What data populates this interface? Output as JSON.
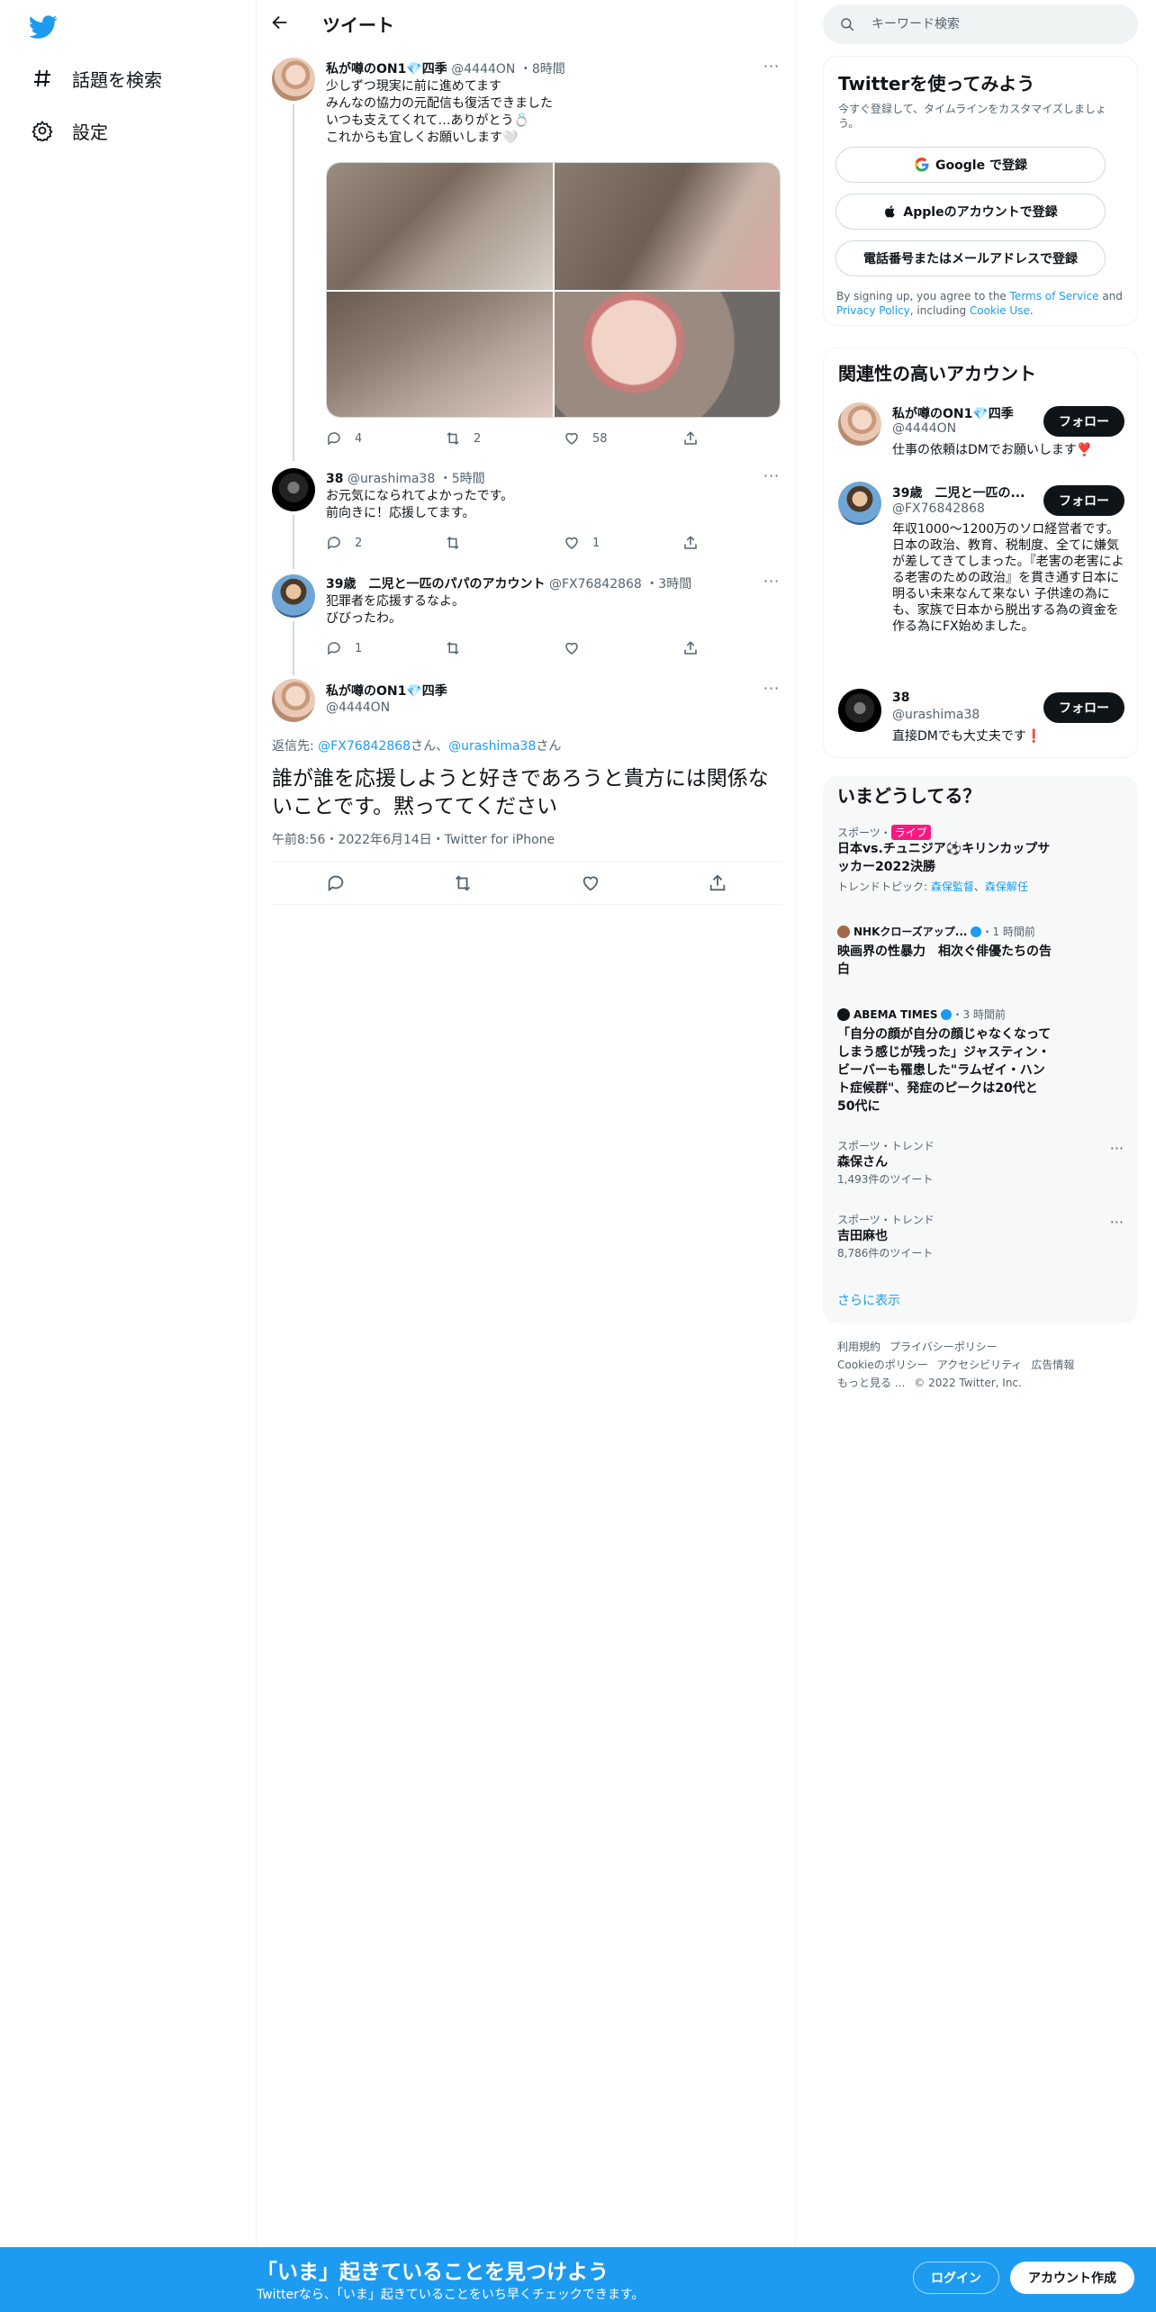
{
  "nav": {
    "explore_label": "話題を検索",
    "settings_label": "設定"
  },
  "header": {
    "title": "ツイート"
  },
  "tweets": [
    {
      "name": "私が噂のON1💎四季",
      "handle": "@4444ON",
      "time": "8時間",
      "text": "少しずつ現実に前に進めてます\nみんなの協力の元配信も復活できました\nいつも支えてくれて…ありがとう💍\nこれからも宜しくお願いします🤍",
      "replies": "4",
      "retweets": "2",
      "likes": "58"
    },
    {
      "name": "38",
      "handle": "@urashima38",
      "time": "5時間",
      "text": "お元気になられてよかったです。\n前向きに！応援してます。",
      "replies": "2",
      "retweets": "",
      "likes": "1"
    },
    {
      "name": "39歳　二児と一匹のパパのアカウント",
      "handle": "@FX76842868",
      "time": "3時間",
      "text": "犯罪者を応援するなよ。\nびびったわ。",
      "replies": "1",
      "retweets": "",
      "likes": ""
    }
  ],
  "focused": {
    "name": "私が噂のON1💎四季",
    "handle": "@4444ON",
    "reply_prefix": "返信先: ",
    "reply_to_1": "@FX76842868",
    "reply_san_1": "さん、",
    "reply_to_2": "@urashima38",
    "reply_san_2": "さん",
    "text": "誰が誰を応援しようと好きであろうと貴方には関係ないことです。黙っててください",
    "meta": "午前8:56・2022年6月14日・Twitter for iPhone"
  },
  "search": {
    "placeholder": "キーワード検索"
  },
  "signup": {
    "title": "Twitterを使ってみよう",
    "subtitle": "今すぐ登録して、タイムラインをカスタマイズしましょう。",
    "google": "Google で登録",
    "apple": "Appleのアカウントで登録",
    "phone": "電話番号またはメールアドレスで登録",
    "legal_1": "By signing up, you agree to the ",
    "terms": "Terms of Service",
    "legal_2": " and ",
    "privacy": "Privacy Policy",
    "legal_3": ", including ",
    "cookie": "Cookie Use",
    "legal_4": "."
  },
  "related": {
    "title": "関連性の高いアカウント",
    "follow": "フォロー",
    "accounts": [
      {
        "name": "私が噂のON1💎四季",
        "handle": "@4444ON",
        "bio": "仕事の依頼はDMでお願いします❣️"
      },
      {
        "name": "39歳　二児と一匹の...",
        "handle": "@FX76842868",
        "bio": "年収1000～1200万のソロ経営者です。 日本の政治、教育、税制度、全てに嫌気が差してきてしまった。『老害の老害による老害のための政治』を貫き通す日本に明るい未来なんて来ない 子供達の為にも、家族で日本から脱出する為の資金を作る為にFX始めました。"
      },
      {
        "name": "38",
        "handle": "@urashima38",
        "bio": "直接DMでも大丈夫です❗️"
      }
    ]
  },
  "trends": {
    "title": "いまどうしてる？",
    "items": [
      {
        "cat": "スポーツ・",
        "live": "ライブ",
        "title": "日本vs.チュニジア⚽キリンカップサッカー2022決勝",
        "topic_prefix": "トレンドトピック: ",
        "topic_1": "森保監督",
        "topic_sep": "、",
        "topic_2": "森保解任"
      },
      {
        "source": "NHKクローズアップ...",
        "time": "・1 時間前",
        "title": "映画界の性暴力　相次ぐ俳優たちの告白"
      },
      {
        "source": "ABEMA TIMES",
        "time": "・3 時間前",
        "title": "「自分の顔が自分の顔じゃなくなってしまう感じが残った」ジャスティン・ビーバーも罹患した\"ラムゼイ・ハント症候群\"、発症のピークは20代と50代に"
      },
      {
        "cat": "スポーツ・トレンド",
        "title": "森保さん",
        "count": "1,493件のツイート"
      },
      {
        "cat": "スポーツ・トレンド",
        "title": "吉田麻也",
        "count": "8,786件のツイート"
      }
    ],
    "more": "さらに表示"
  },
  "footer": {
    "terms": "利用規約",
    "privacy": "プライバシーポリシー",
    "cookie": "Cookieのポリシー",
    "access": "アクセシビリティ",
    "ads": "広告情報",
    "more": "もっと見る ...",
    "copyright": "© 2022 Twitter, Inc."
  },
  "banner": {
    "headline": "「いま」起きていることを見つけよう",
    "sub": "Twitterなら、「いま」起きていることをいち早くチェックできます。",
    "login": "ログイン",
    "signup": "アカウント作成"
  },
  "colors": {
    "accent": "#1d9bf0",
    "text": "#0f1419",
    "muted": "#536471",
    "live": "#f91880"
  }
}
